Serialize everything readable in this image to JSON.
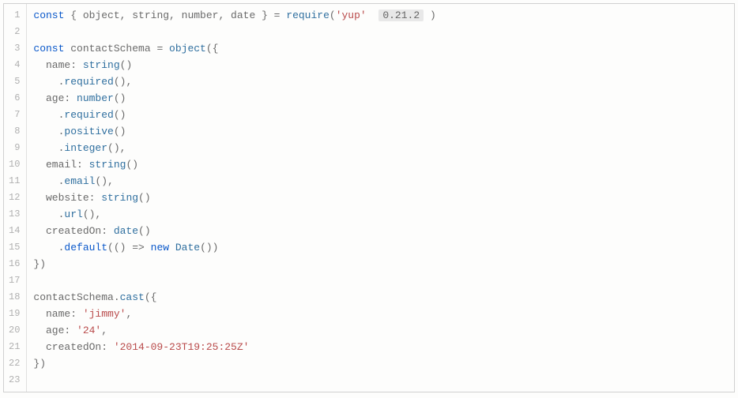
{
  "editor": {
    "package": "yup",
    "version": "0.21.2",
    "lines": [
      {
        "n": 1,
        "seg": [
          [
            "kw",
            "const"
          ],
          [
            "",
            " { object, string, number, date } = "
          ],
          [
            "fn",
            "require"
          ],
          [
            "",
            "("
          ],
          [
            "str",
            "'yup'"
          ],
          [
            "",
            "  "
          ],
          [
            "badge",
            "0.21.2"
          ],
          [
            "",
            " )"
          ]
        ]
      },
      {
        "n": 2,
        "seg": []
      },
      {
        "n": 3,
        "seg": [
          [
            "kw",
            "const"
          ],
          [
            "",
            " contactSchema = "
          ],
          [
            "fn",
            "object"
          ],
          [
            "",
            "({"
          ]
        ]
      },
      {
        "n": 4,
        "seg": [
          [
            "",
            "  name: "
          ],
          [
            "fn",
            "string"
          ],
          [
            "",
            "()"
          ]
        ]
      },
      {
        "n": 5,
        "seg": [
          [
            "",
            "    ."
          ],
          [
            "fn",
            "required"
          ],
          [
            "",
            "(),"
          ]
        ]
      },
      {
        "n": 6,
        "seg": [
          [
            "",
            "  age: "
          ],
          [
            "fn",
            "number"
          ],
          [
            "",
            "()"
          ]
        ]
      },
      {
        "n": 7,
        "seg": [
          [
            "",
            "    ."
          ],
          [
            "fn",
            "required"
          ],
          [
            "",
            "()"
          ]
        ]
      },
      {
        "n": 8,
        "seg": [
          [
            "",
            "    ."
          ],
          [
            "fn",
            "positive"
          ],
          [
            "",
            "()"
          ]
        ]
      },
      {
        "n": 9,
        "seg": [
          [
            "",
            "    ."
          ],
          [
            "fn",
            "integer"
          ],
          [
            "",
            "(),"
          ]
        ]
      },
      {
        "n": 10,
        "seg": [
          [
            "",
            "  email: "
          ],
          [
            "fn",
            "string"
          ],
          [
            "",
            "()"
          ]
        ]
      },
      {
        "n": 11,
        "seg": [
          [
            "",
            "    ."
          ],
          [
            "fn",
            "email"
          ],
          [
            "",
            "(),"
          ]
        ]
      },
      {
        "n": 12,
        "seg": [
          [
            "",
            "  website: "
          ],
          [
            "fn",
            "string"
          ],
          [
            "",
            "()"
          ]
        ]
      },
      {
        "n": 13,
        "seg": [
          [
            "",
            "    ."
          ],
          [
            "fn",
            "url"
          ],
          [
            "",
            "(),"
          ]
        ]
      },
      {
        "n": 14,
        "seg": [
          [
            "",
            "  createdOn: "
          ],
          [
            "fn",
            "date"
          ],
          [
            "",
            "()"
          ]
        ]
      },
      {
        "n": 15,
        "seg": [
          [
            "",
            "    ."
          ],
          [
            "kw",
            "default"
          ],
          [
            "",
            "(() => "
          ],
          [
            "kw",
            "new"
          ],
          [
            "",
            " "
          ],
          [
            "fn",
            "Date"
          ],
          [
            "",
            "())"
          ]
        ]
      },
      {
        "n": 16,
        "seg": [
          [
            "",
            "})"
          ]
        ]
      },
      {
        "n": 17,
        "seg": []
      },
      {
        "n": 18,
        "seg": [
          [
            "",
            "contactSchema."
          ],
          [
            "fn",
            "cast"
          ],
          [
            "",
            "({"
          ]
        ]
      },
      {
        "n": 19,
        "seg": [
          [
            "",
            "  name: "
          ],
          [
            "str",
            "'jimmy'"
          ],
          [
            "",
            ","
          ]
        ]
      },
      {
        "n": 20,
        "seg": [
          [
            "",
            "  age: "
          ],
          [
            "str",
            "'24'"
          ],
          [
            "",
            ","
          ]
        ]
      },
      {
        "n": 21,
        "seg": [
          [
            "",
            "  createdOn: "
          ],
          [
            "str",
            "'2014-09-23T19:25:25Z'"
          ]
        ]
      },
      {
        "n": 22,
        "seg": [
          [
            "",
            "})"
          ]
        ]
      },
      {
        "n": 23,
        "seg": []
      }
    ]
  }
}
